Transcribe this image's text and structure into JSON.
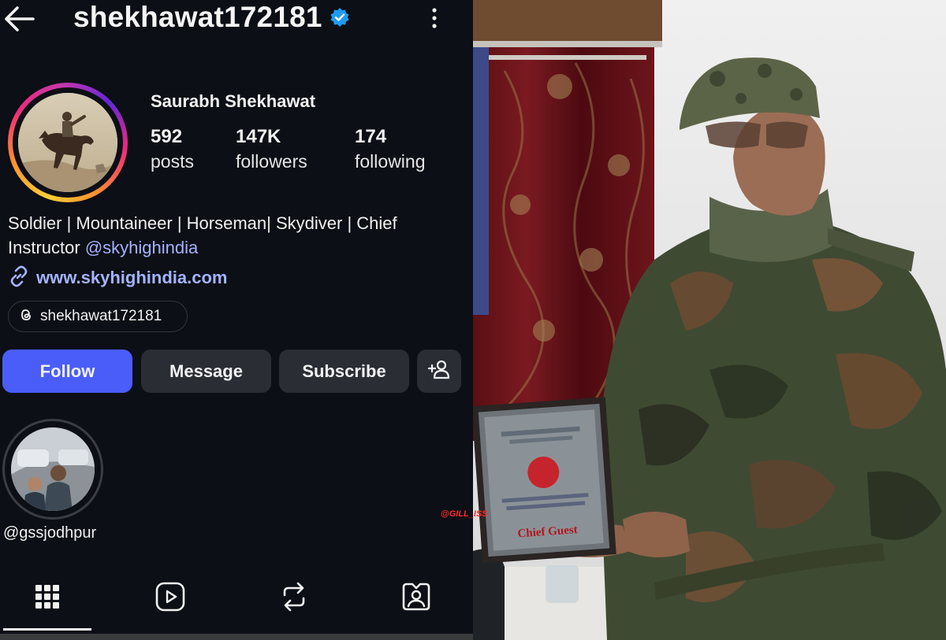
{
  "header": {
    "username": "shekhawat172181",
    "back_icon": "arrow-left-icon",
    "verified_icon": "verified-badge-icon",
    "more_icon": "more-vertical-icon"
  },
  "profile": {
    "full_name": "Saurabh Shekhawat",
    "stats": [
      {
        "value": "592",
        "label": "posts"
      },
      {
        "value": "147K",
        "label": "followers"
      },
      {
        "value": "174",
        "label": "following"
      }
    ],
    "bio_line1": "Soldier | Mountaineer | Horseman| Skydiver | Chief",
    "bio_line2_prefix": "Instructor ",
    "bio_mention": "@skyhighindia",
    "website": "www.skyhighindia.com",
    "threads_handle": "shekhawat172181"
  },
  "actions": {
    "follow": "Follow",
    "message": "Message",
    "subscribe": "Subscribe",
    "add_person_icon": "add-person-icon"
  },
  "highlights": [
    {
      "label": "@gssjodhpur"
    }
  ],
  "tabs": [
    {
      "name": "grid-icon",
      "active": true
    },
    {
      "name": "reels-icon",
      "active": false
    },
    {
      "name": "reposts-icon",
      "active": false
    },
    {
      "name": "tagged-icon",
      "active": false
    }
  ],
  "photo": {
    "plaque_title": "Chief Guest",
    "watermark": "@GILL_ISS"
  },
  "colors": {
    "accent_blue": "#4a5df9",
    "link": "#a3b3ff",
    "button_bg": "#2a2e34",
    "verified": "#1d9bf0"
  }
}
